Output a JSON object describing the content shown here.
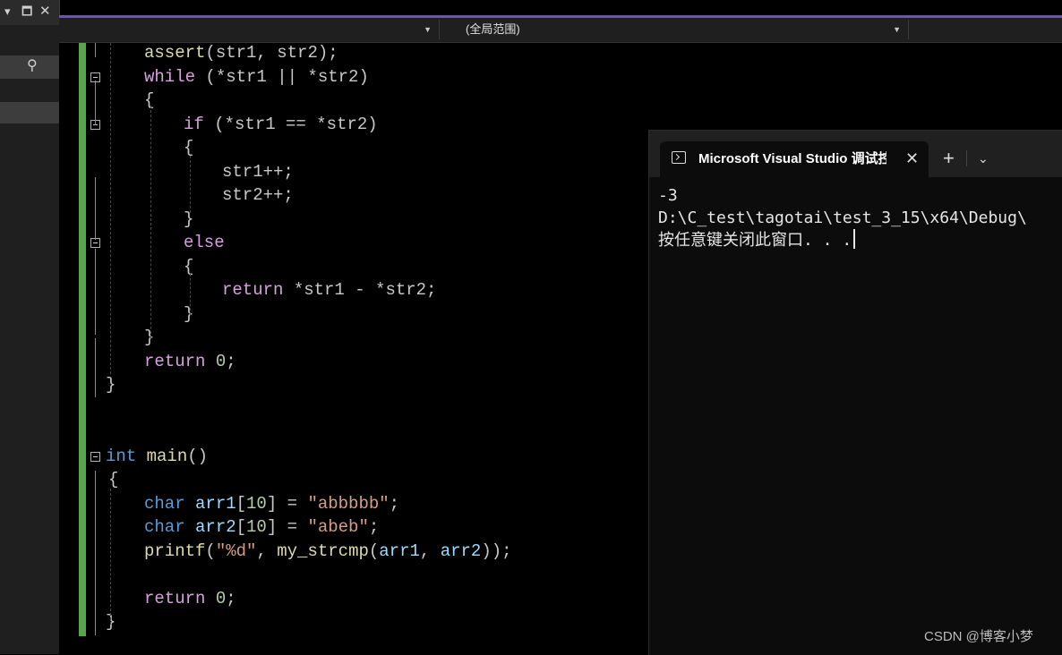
{
  "nav": {
    "scope": "(全局范围)"
  },
  "editor": {
    "lines": [
      {
        "tokens": [
          [
            "fn",
            "assert"
          ],
          [
            "pl",
            "(str1, str2);"
          ]
        ]
      },
      {
        "tokens": [
          [
            "kw",
            "while"
          ],
          [
            "pl",
            " (*str1 || *str2)"
          ]
        ]
      },
      {
        "tokens": [
          [
            "pl",
            "{"
          ]
        ]
      },
      {
        "tokens": [
          [
            "kw",
            "if"
          ],
          [
            "pl",
            " (*str1 == *str2)"
          ]
        ]
      },
      {
        "tokens": [
          [
            "pl",
            "{"
          ]
        ]
      },
      {
        "tokens": [
          [
            "pl",
            "str1++;"
          ]
        ]
      },
      {
        "tokens": [
          [
            "pl",
            "str2++;"
          ]
        ]
      },
      {
        "tokens": [
          [
            "pl",
            "}"
          ]
        ]
      },
      {
        "tokens": [
          [
            "kw",
            "else"
          ]
        ]
      },
      {
        "tokens": [
          [
            "pl",
            "{"
          ]
        ]
      },
      {
        "tokens": [
          [
            "kw",
            "return"
          ],
          [
            "pl",
            " *str1 - *str2;"
          ]
        ]
      },
      {
        "tokens": [
          [
            "pl",
            "}"
          ]
        ]
      },
      {
        "tokens": [
          [
            "pl",
            "}"
          ]
        ]
      },
      {
        "tokens": [
          [
            "kw",
            "return"
          ],
          [
            "pl",
            " "
          ],
          [
            "num",
            "0"
          ],
          [
            "pl",
            ";"
          ]
        ]
      },
      {
        "tokens": [
          [
            "pl",
            "}"
          ]
        ]
      },
      {
        "tokens": []
      },
      {
        "tokens": []
      },
      {
        "tokens": [
          [
            "ty",
            "int"
          ],
          [
            "pl",
            " "
          ],
          [
            "fn",
            "main"
          ],
          [
            "pl",
            "()"
          ]
        ]
      },
      {
        "tokens": [
          [
            "pl",
            "{"
          ]
        ]
      },
      {
        "tokens": [
          [
            "ty",
            "char"
          ],
          [
            "pl",
            " "
          ],
          [
            "var",
            "arr1"
          ],
          [
            "pl",
            "["
          ],
          [
            "num",
            "10"
          ],
          [
            "pl",
            "] = "
          ],
          [
            "str",
            "\"abbbbb\""
          ],
          [
            "pl",
            ";"
          ]
        ]
      },
      {
        "tokens": [
          [
            "ty",
            "char"
          ],
          [
            "pl",
            " "
          ],
          [
            "var",
            "arr2"
          ],
          [
            "pl",
            "["
          ],
          [
            "num",
            "10"
          ],
          [
            "pl",
            "] = "
          ],
          [
            "str",
            "\"abeb\""
          ],
          [
            "pl",
            ";"
          ]
        ]
      },
      {
        "tokens": [
          [
            "fn",
            "printf"
          ],
          [
            "pl",
            "("
          ],
          [
            "str",
            "\"%d\""
          ],
          [
            "pl",
            ", "
          ],
          [
            "fn",
            "my_strcmp"
          ],
          [
            "pl",
            "("
          ],
          [
            "var",
            "arr1"
          ],
          [
            "pl",
            ", "
          ],
          [
            "var",
            "arr2"
          ],
          [
            "pl",
            "));"
          ]
        ]
      },
      {
        "tokens": []
      },
      {
        "tokens": [
          [
            "kw",
            "return"
          ],
          [
            "pl",
            " "
          ],
          [
            "num",
            "0"
          ],
          [
            "pl",
            ";"
          ]
        ]
      },
      {
        "tokens": [
          [
            "pl",
            "}"
          ]
        ]
      }
    ]
  },
  "console": {
    "tab_title": "Microsoft Visual Studio 调试控制台",
    "close_glyph": "✕",
    "add_glyph": "+",
    "dropdown_glyph": "⌄",
    "output": [
      "-3",
      "D:\\C_test\\tagotai\\test_3_15\\x64\\Debug\\",
      "按任意键关闭此窗口. . ."
    ]
  },
  "side": {
    "dropdown_glyph": "▾",
    "pin_glyph": "🗖",
    "close_glyph": "✕",
    "search_glyph": "⚲"
  },
  "watermark": "CSDN @博客小梦"
}
